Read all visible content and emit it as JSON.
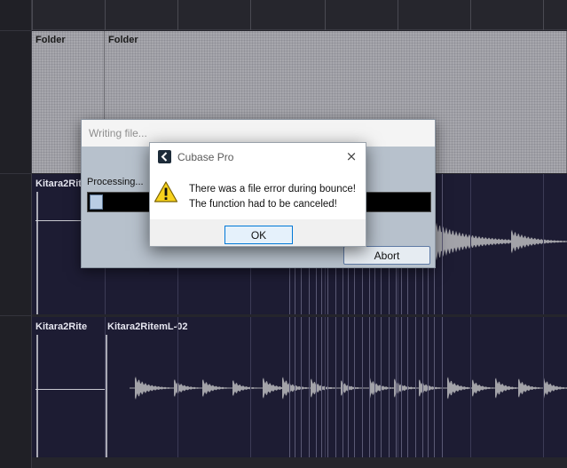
{
  "project": {
    "folder_parts": [
      "Folder",
      "Folder"
    ],
    "track1_events": [
      "Kitara2Rite"
    ],
    "track2_events": [
      "Kitara2Rite",
      "Kitara2RitemL-02"
    ]
  },
  "writing_dialog": {
    "title": "Writing file...",
    "status": "Processing...",
    "progress": 0.04,
    "abort_label": "Abort"
  },
  "error_dialog": {
    "title": "Cubase Pro",
    "close_icon": "×",
    "message_line1": "There was a file error during bounce!",
    "message_line2": "The function had to be canceled!",
    "ok_label": "OK",
    "icon": "warning-icon"
  },
  "colors": {
    "folder": "#a7a7ad",
    "audio_lane": "#1d1c33",
    "waveform": "#a3a3a9",
    "dialog_bg": "#b7c1cc"
  }
}
